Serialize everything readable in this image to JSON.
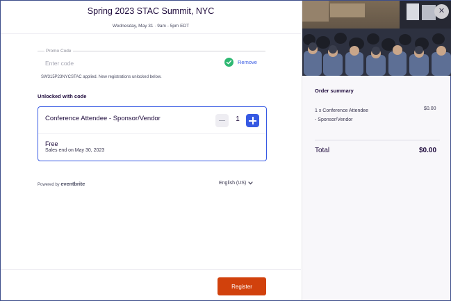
{
  "event": {
    "title": "Spring 2023 STAC Summit, NYC",
    "datetime": "Wednesday, May 31 · 9am - 5pm EDT"
  },
  "promo": {
    "label": "Promo Code",
    "placeholder": "Enter code",
    "remove_label": "Remove",
    "applied_message": "SW315P23NYCSTAC applied. New registrations unlocked below."
  },
  "unlocked": {
    "heading": "Unlocked with code"
  },
  "ticket": {
    "name": "Conference Attendee - Sponsor/Vendor",
    "quantity": "1",
    "price": "Free",
    "sales_end": "Sales end on May 30, 2023"
  },
  "footer": {
    "powered_by": "Powered by",
    "brand": "eventbrite",
    "language": "English (US)",
    "register_label": "Register"
  },
  "summary": {
    "title": "Order summary",
    "item_desc": "1 x Conference Attendee - Sponsor/Vendor",
    "item_price": "$0.00",
    "total_label": "Total",
    "total_value": "$0.00"
  },
  "colors": {
    "accent": "#3659e3",
    "register": "#d1410c",
    "success": "#2eb872"
  }
}
